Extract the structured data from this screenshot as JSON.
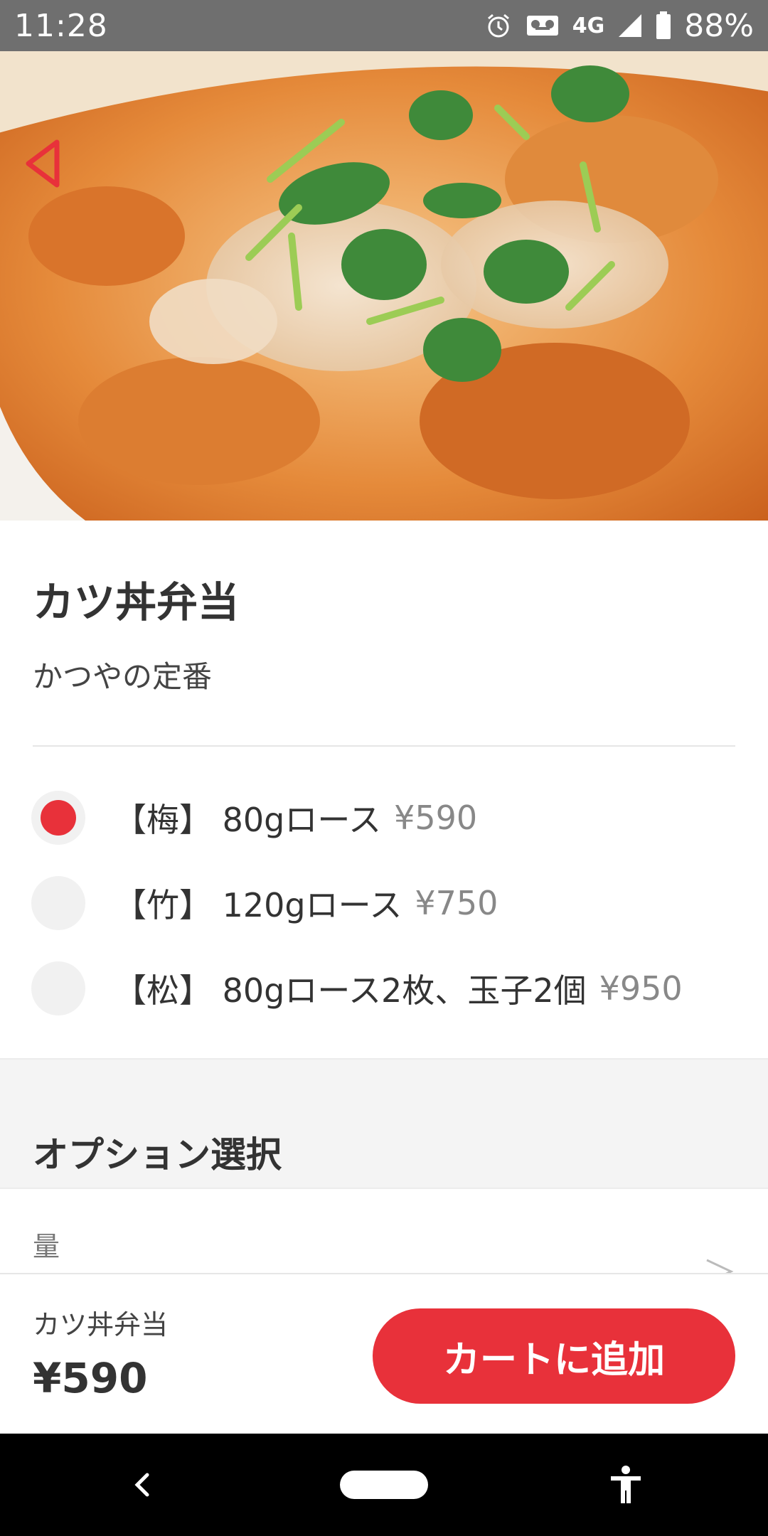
{
  "status_bar": {
    "time": "11:28",
    "network": "4G",
    "battery": "88%"
  },
  "product": {
    "name": "カツ丼弁当",
    "description": "かつやの定番"
  },
  "variants": [
    {
      "label": "【梅】 80gロース",
      "price": "¥590",
      "selected": true
    },
    {
      "label": "【竹】 120gロース",
      "price": "¥750",
      "selected": false
    },
    {
      "label": "【松】 80gロース2枚、玉子2個",
      "price": "¥950",
      "selected": false
    }
  ],
  "options_section": {
    "title": "オプション選択",
    "rows": [
      {
        "label": "量"
      }
    ]
  },
  "bottom_bar": {
    "name": "カツ丼弁当",
    "price": "¥590",
    "add_to_cart_label": "カートに追加"
  },
  "colors": {
    "accent": "#e8313a",
    "status_bar": "#6f6f6f",
    "nav_bar": "#000000"
  },
  "icons": {
    "back": "back-arrow-icon",
    "chevron": "chevron-right-icon",
    "alarm": "alarm-icon",
    "voicemail": "voicemail-icon",
    "signal": "signal-icon",
    "battery": "battery-icon"
  }
}
